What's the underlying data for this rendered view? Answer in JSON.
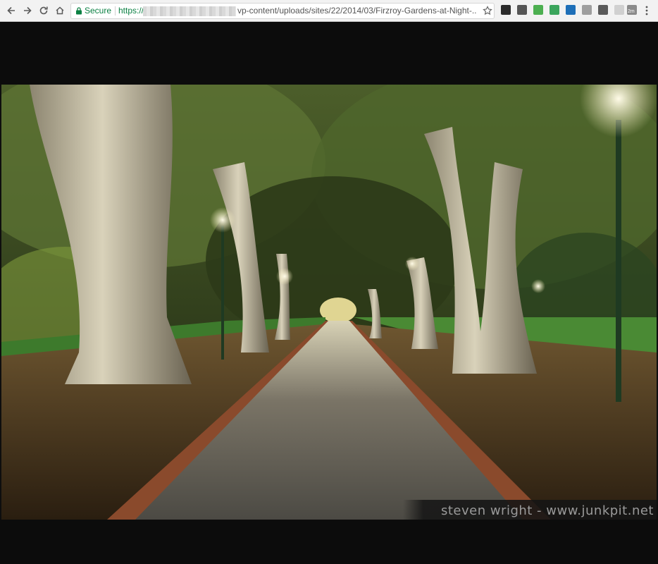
{
  "browser": {
    "secure_label": "Secure",
    "url_scheme": "https://",
    "url_path": "vp-content/uploads/sites/22/2014/03/Firzroy-Gardens-at-Night-...",
    "extensions": [
      {
        "name": "camera-extension-icon",
        "color": "#2b2b2b"
      },
      {
        "name": "download-extension-icon",
        "color": "#555555"
      },
      {
        "name": "green-square-extension-icon",
        "color": "#4caf50"
      },
      {
        "name": "leaf-extension-icon",
        "color": "#3ba55c"
      },
      {
        "name": "analytics-extension-icon",
        "color": "#1e6fb8"
      },
      {
        "name": "drive-extension-icon",
        "color": "#9e9e9e"
      },
      {
        "name": "screenshot-extension-icon",
        "color": "#5a5a5a"
      },
      {
        "name": "blank-extension-icon",
        "color": "#d0d0d0"
      }
    ],
    "badge_text": "2m"
  },
  "photo": {
    "watermark": "steven wright - www.junkpit.net"
  }
}
